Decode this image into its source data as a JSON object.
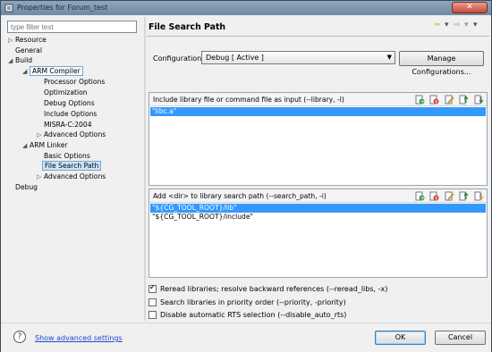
{
  "window": {
    "title": "Properties for Forum_test"
  },
  "filter": {
    "placeholder": "type filter text"
  },
  "tree": [
    {
      "label": "Resource",
      "twisty": "▷"
    },
    {
      "label": "General",
      "twisty": ""
    },
    {
      "label": "Build",
      "twisty": "◢"
    },
    {
      "label": "ARM Compiler",
      "twisty": "◢"
    },
    {
      "label": "Processor Options",
      "twisty": ""
    },
    {
      "label": "Optimization",
      "twisty": ""
    },
    {
      "label": "Debug Options",
      "twisty": ""
    },
    {
      "label": "Include Options",
      "twisty": ""
    },
    {
      "label": "MISRA-C:2004",
      "twisty": ""
    },
    {
      "label": "Advanced Options",
      "twisty": "▷"
    },
    {
      "label": "ARM Linker",
      "twisty": "◢"
    },
    {
      "label": "Basic Options",
      "twisty": ""
    },
    {
      "label": "File Search Path",
      "twisty": ""
    },
    {
      "label": "Advanced Options",
      "twisty": "▷"
    },
    {
      "label": "Debug",
      "twisty": ""
    }
  ],
  "page": {
    "title": "File Search Path"
  },
  "configuration": {
    "label": "Configuration:",
    "value": "Debug  [ Active ]",
    "manage_label": "Manage Configurations..."
  },
  "include_group": {
    "header": "Include library file or command file as input (--library, -l)",
    "items": [
      "\"libc.a\""
    ]
  },
  "search_group": {
    "header": "Add <dir> to library search path (--search_path, -i)",
    "items": [
      "\"${CG_TOOL_ROOT}/lib\"",
      "\"${CG_TOOL_ROOT}/include\""
    ]
  },
  "options": [
    {
      "label": "Reread libraries; resolve backward references (--reread_libs, -x)",
      "checked": true
    },
    {
      "label": "Search libraries in priority order (--priority, -priority)",
      "checked": false
    },
    {
      "label": "Disable automatic RTS selection (--disable_auto_rts)",
      "checked": false
    }
  ],
  "footer": {
    "help_icon": "?",
    "advanced_link": "Show advanced settings",
    "ok_label": "OK",
    "cancel_label": "Cancel"
  },
  "colors": {
    "selection": "#3399ff",
    "link": "#1a4ad0"
  }
}
